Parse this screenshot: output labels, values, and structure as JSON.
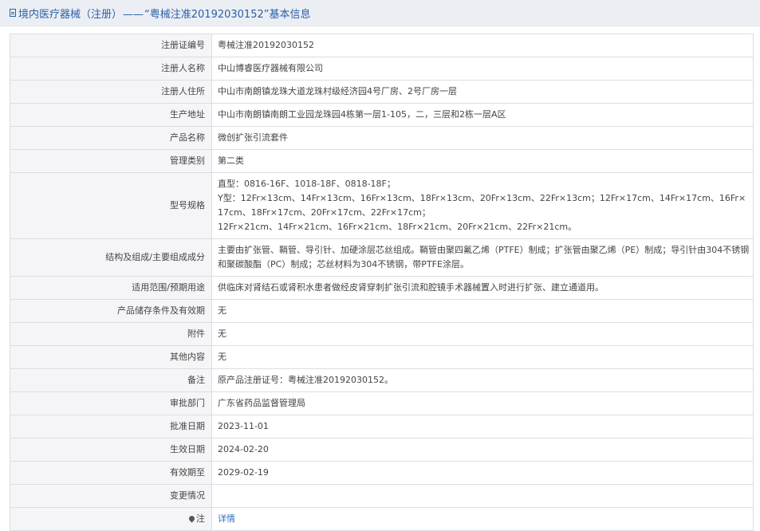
{
  "header": {
    "prefix": "境内医疗器械（注册）",
    "separator": "——",
    "number": "“粤械注准20192030152”",
    "suffix": "基本信息"
  },
  "rows": [
    {
      "key": "注册证编号",
      "value": "粤械注准20192030152"
    },
    {
      "key": "注册人名称",
      "value": "中山博睿医疗器械有限公司"
    },
    {
      "key": "注册人住所",
      "value": "中山市南朗镇龙珠大道龙珠村级经济园4号厂房、2号厂房一层"
    },
    {
      "key": "生产地址",
      "value": "中山市南朗镇南朗工业园龙珠园4栋第一层1-105，二，三层和2栋一层A区"
    },
    {
      "key": "产品名称",
      "value": "微创扩张引流套件"
    },
    {
      "key": "管理类别",
      "value": "第二类"
    },
    {
      "key": "型号规格",
      "lines": [
        "直型：0816-16F、1018-18F、0818-18F；",
        "Y型：12Fr×13cm、14Fr×13cm、16Fr×13cm、18Fr×13cm、20Fr×13cm、22Fr×13cm；12Fr×17cm、14Fr×17cm、16Fr×17cm、18Fr×17cm、20Fr×17cm、22Fr×17cm；",
        "12Fr×21cm、14Fr×21cm、16Fr×21cm、18Fr×21cm、20Fr×21cm、22Fr×21cm。"
      ]
    },
    {
      "key": "结构及组成/主要组成成分",
      "value": "主要由扩张管、鞘管、导引针、加硬涂层芯丝组成。鞘管由聚四氟乙烯（PTFE）制成；扩张管由聚乙烯（PE）制成；导引针由304不锈钢和聚碳酸酯（PC）制成；芯丝材料为304不锈钢，带PTFE涂层。"
    },
    {
      "key": "适用范围/预期用途",
      "value": "供临床对肾结石或肾积水患者做经皮肾穿刺扩张引流和腔镜手术器械置入时进行扩张、建立通道用。"
    },
    {
      "key": "产品储存条件及有效期",
      "value": "无"
    },
    {
      "key": "附件",
      "value": "无"
    },
    {
      "key": "其他内容",
      "value": "无"
    },
    {
      "key": "备注",
      "value": "原产品注册证号：粤械注准20192030152。"
    },
    {
      "key": "审批部门",
      "value": "广东省药品监督管理局"
    },
    {
      "key": "批准日期",
      "value": "2023-11-01"
    },
    {
      "key": "生效日期",
      "value": "2024-02-20"
    },
    {
      "key": "有效期至",
      "value": "2029-02-19"
    },
    {
      "key": "变更情况",
      "value": ""
    },
    {
      "key": "注",
      "value": "详情"
    }
  ],
  "icons": {
    "header_icon": "document-icon",
    "note_icon": "pin-icon"
  },
  "colors": {
    "title_blue": "#2b5fa8",
    "link_blue": "#2b6fc2",
    "key_bg": "#f5f5f7"
  }
}
